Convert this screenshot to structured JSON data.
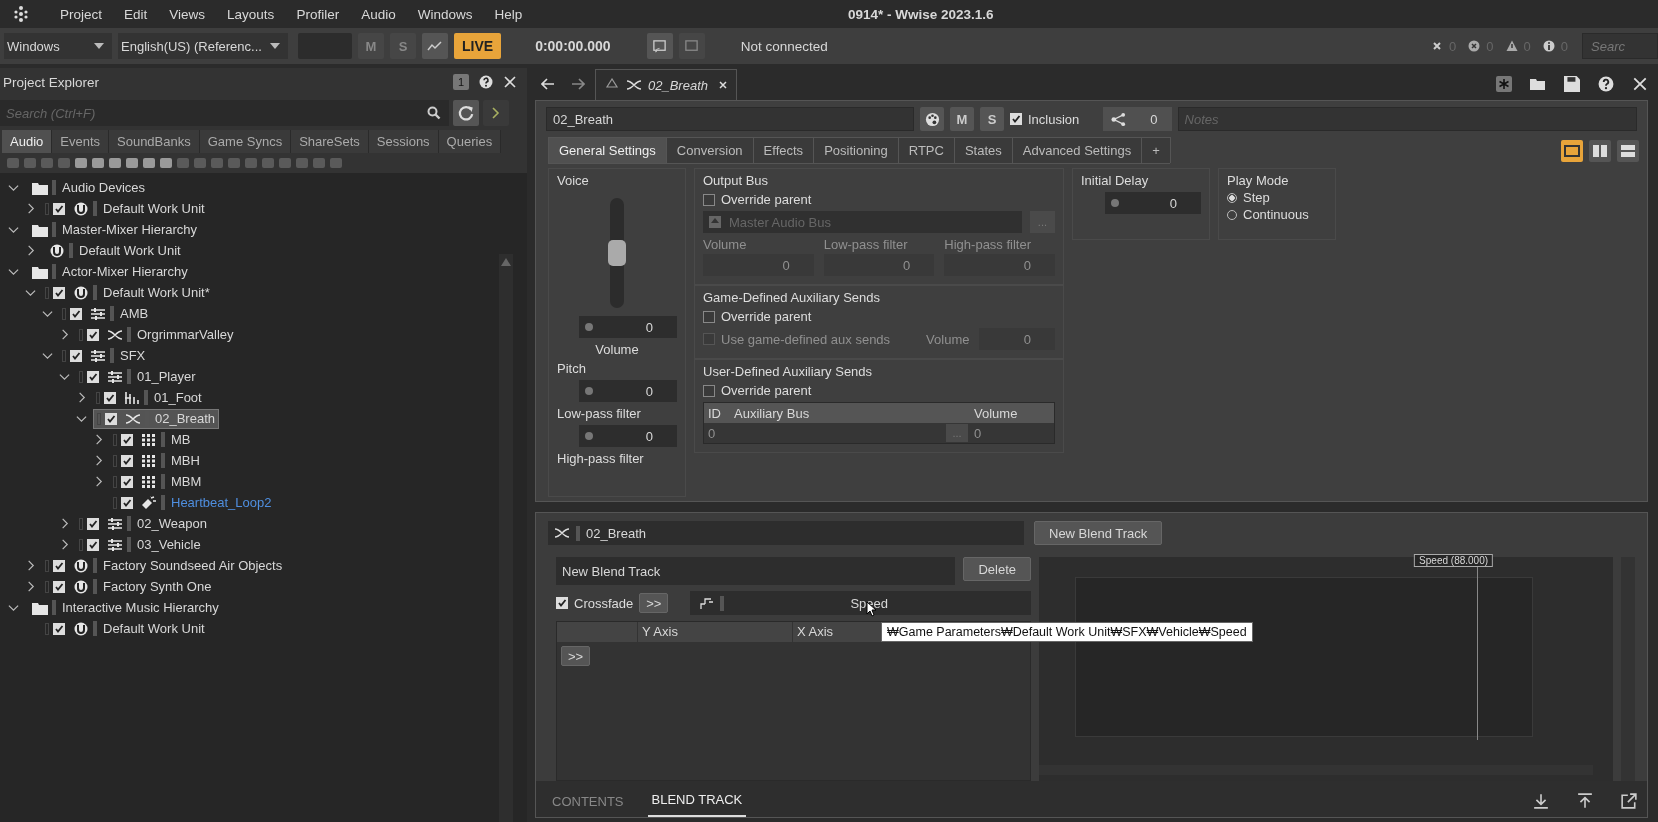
{
  "menu": {
    "items": [
      "Project",
      "Edit",
      "Views",
      "Layouts",
      "Profiler",
      "Audio",
      "Windows",
      "Help"
    ],
    "title": "0914* - Wwise 2023.1.6"
  },
  "toolbar": {
    "platform": "Windows",
    "language": "English(US) (Referenc...",
    "mute": "M",
    "solo": "S",
    "live": "LIVE",
    "time": "0:00:00.000",
    "connection": "Not connected",
    "counts": [
      {
        "kind": "clear",
        "value": "0"
      },
      {
        "kind": "error",
        "value": "0"
      },
      {
        "kind": "warning",
        "value": "0"
      },
      {
        "kind": "info",
        "value": "0"
      }
    ],
    "search": {
      "placeholder": "Searc"
    }
  },
  "project_explorer": {
    "title": "Project Explorer",
    "badge": "1",
    "search": {
      "placeholder": "Search (Ctrl+F)"
    },
    "tabs": [
      {
        "label": "Audio",
        "selected": true
      },
      {
        "label": "Events",
        "selected": false
      },
      {
        "label": "SoundBanks",
        "selected": false
      },
      {
        "label": "Game Syncs",
        "selected": false
      },
      {
        "label": "ShareSets",
        "selected": false
      },
      {
        "label": "Sessions",
        "selected": false
      },
      {
        "label": "Queries",
        "selected": false
      }
    ],
    "tree": [
      {
        "name": "Audio Devices",
        "kind": "folder",
        "expanded": true,
        "selected": false,
        "children": [
          {
            "name": "Default Work Unit",
            "kind": "workunit",
            "checked": true,
            "expanded": false,
            "selected": false
          }
        ]
      },
      {
        "name": "Master-Mixer Hierarchy",
        "kind": "folder",
        "expanded": true,
        "selected": false,
        "children": [
          {
            "name": "Default Work Unit",
            "kind": "workunit",
            "expanded": false,
            "selected": false
          }
        ]
      },
      {
        "name": "Actor-Mixer Hierarchy",
        "kind": "folder",
        "expanded": true,
        "selected": false,
        "children": [
          {
            "name": "Default Work Unit*",
            "kind": "workunit",
            "checked": true,
            "expanded": true,
            "selected": false,
            "children": [
              {
                "name": "AMB",
                "kind": "mixer",
                "checked": true,
                "expanded": true,
                "selected": false,
                "children": [
                  {
                    "name": "OrgrimmarValley",
                    "kind": "blend",
                    "checked": true,
                    "expanded": false,
                    "selected": false
                  }
                ]
              },
              {
                "name": "SFX",
                "kind": "mixer",
                "checked": true,
                "expanded": true,
                "selected": false,
                "children": [
                  {
                    "name": "01_Player",
                    "kind": "mixer",
                    "checked": true,
                    "expanded": true,
                    "selected": false,
                    "children": [
                      {
                        "name": "01_Foot",
                        "kind": "switch",
                        "checked": true,
                        "expanded": false,
                        "selected": false
                      },
                      {
                        "name": "02_Breath",
                        "kind": "blend",
                        "checked": true,
                        "expanded": true,
                        "selected": true,
                        "children": [
                          {
                            "name": "MB",
                            "kind": "matrix",
                            "checked": true,
                            "expanded": false,
                            "selected": false
                          },
                          {
                            "name": "MBH",
                            "kind": "matrix",
                            "checked": true,
                            "expanded": false,
                            "selected": false
                          },
                          {
                            "name": "MBM",
                            "kind": "matrix",
                            "checked": true,
                            "expanded": false,
                            "selected": false
                          },
                          {
                            "name": "Heartbeat_Loop2",
                            "kind": "sound",
                            "checked": true,
                            "selected": false
                          }
                        ]
                      }
                    ]
                  },
                  {
                    "name": "02_Weapon",
                    "kind": "mixer",
                    "checked": true,
                    "expanded": false,
                    "selected": false
                  },
                  {
                    "name": "03_Vehicle",
                    "kind": "mixer",
                    "checked": true,
                    "expanded": false,
                    "selected": false
                  }
                ]
              }
            ]
          },
          {
            "name": "Factory Soundseed Air Objects",
            "kind": "workunit",
            "checked": true,
            "expanded": false,
            "selected": false
          },
          {
            "name": "Factory Synth One",
            "kind": "workunit",
            "checked": true,
            "expanded": false,
            "selected": false
          }
        ]
      },
      {
        "name": "Interactive Music Hierarchy",
        "kind": "folder",
        "expanded": true,
        "selected": false,
        "children": [
          {
            "name": "Default Work Unit",
            "kind": "workunit",
            "checked": true,
            "selected": false
          }
        ]
      }
    ]
  },
  "editor": {
    "tab": {
      "title": "02_Breath"
    },
    "name": "02_Breath",
    "mute": "M",
    "solo": "S",
    "inclusion": {
      "label": "Inclusion",
      "checked": true
    },
    "references": "0",
    "notes": {
      "placeholder": "Notes"
    },
    "tabs": [
      {
        "label": "General Settings",
        "selected": true
      },
      {
        "label": "Conversion",
        "selected": false
      },
      {
        "label": "Effects",
        "selected": false
      },
      {
        "label": "Positioning",
        "selected": false
      },
      {
        "label": "RTPC",
        "selected": false
      },
      {
        "label": "States",
        "selected": false
      },
      {
        "label": "Advanced Settings",
        "selected": false
      },
      {
        "label": "+",
        "selected": false
      }
    ],
    "view_modes": [
      {
        "kind": "single",
        "selected": true
      },
      {
        "kind": "split",
        "selected": false
      },
      {
        "kind": "stacked",
        "selected": false
      }
    ],
    "voice": {
      "title": "Voice",
      "level": 0.5,
      "volume": {
        "value": "0",
        "label": "Volume"
      },
      "pitch": {
        "label": "Pitch",
        "value": "0"
      },
      "lowpass": {
        "label": "Low-pass filter",
        "value": "0"
      },
      "highpass": {
        "label": "High-pass filter"
      }
    },
    "output_bus": {
      "title": "Output Bus",
      "override": {
        "label": "Override parent",
        "checked": false
      },
      "bus": {
        "name": "Master Audio Bus",
        "disabled": true
      },
      "browse": "...",
      "fields": [
        {
          "label": "Volume",
          "value": "0",
          "disabled": true
        },
        {
          "label": "Low-pass filter",
          "value": "0",
          "disabled": true
        },
        {
          "label": "High-pass filter",
          "value": "0",
          "disabled": true
        }
      ]
    },
    "game_aux": {
      "title": "Game-Defined Auxiliary Sends",
      "override": {
        "label": "Override parent",
        "checked": false
      },
      "use_game": {
        "label": "Use game-defined aux sends",
        "checked": false,
        "disabled": true
      },
      "volume": {
        "label": "Volume",
        "value": "0",
        "disabled": true
      }
    },
    "user_aux": {
      "title": "User-Defined Auxiliary Sends",
      "override": {
        "label": "Override parent",
        "checked": false
      },
      "columns": [
        "ID",
        "Auxiliary Bus",
        "Volume"
      ],
      "rows": [
        {
          "id": "0",
          "browse": "...",
          "volume": "0"
        }
      ]
    },
    "initial_delay": {
      "title": "Initial Delay",
      "value": "0"
    },
    "play_mode": {
      "title": "Play Mode",
      "options": [
        {
          "label": "Step",
          "selected": true
        },
        {
          "label": "Continuous",
          "selected": false
        }
      ]
    }
  },
  "blend": {
    "container": "02_Breath",
    "new_track": "New Blend Track",
    "track": {
      "name": "New Blend Track",
      "delete": "Delete",
      "crossfade": {
        "label": "Crossfade",
        "checked": true
      },
      "expand": ">>",
      "parameter": "Speed",
      "columns": [
        "Y Axis",
        "X Axis"
      ],
      "expand_rows": ">>"
    },
    "graph": {
      "marker": "Speed (88.000)",
      "level": 0.88
    },
    "tooltip": "₩Game Parameters₩Default Work Unit₩SFX₩Vehicle₩Speed",
    "tabs": [
      {
        "label": "CONTENTS",
        "selected": false
      },
      {
        "label": "BLEND TRACK",
        "selected": true
      }
    ]
  }
}
